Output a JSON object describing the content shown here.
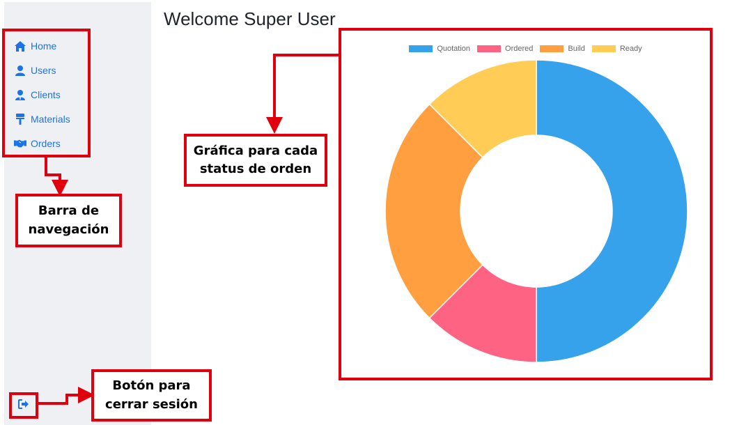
{
  "page": {
    "title": "Welcome Super User"
  },
  "sidebar": {
    "items": [
      {
        "label": "Home",
        "icon": "home-icon"
      },
      {
        "label": "Users",
        "icon": "user-icon"
      },
      {
        "label": "Clients",
        "icon": "client-icon"
      },
      {
        "label": "Materials",
        "icon": "paint-roller-icon"
      },
      {
        "label": "Orders",
        "icon": "handshake-icon"
      }
    ],
    "logout_icon": "sign-out-icon"
  },
  "annotations": {
    "nav_bar": "Barra de\nnavegación",
    "chart": "Gráfica para cada\nstatus de orden",
    "logout": "Botón para\ncerrar sesión",
    "color": "#e0000d"
  },
  "chart_data": {
    "type": "doughnut",
    "labels": [
      "Quotation",
      "Ordered",
      "Build",
      "Ready"
    ],
    "values": [
      50,
      12.5,
      25,
      12.5
    ],
    "colors": [
      "#36a2eb",
      "#ff6384",
      "#ff9f40",
      "#ffcd56"
    ],
    "legend": "top"
  }
}
